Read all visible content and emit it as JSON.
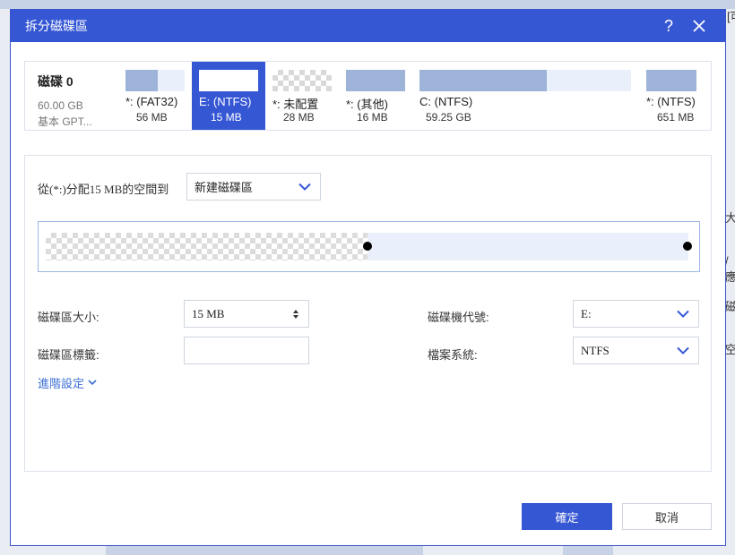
{
  "dialog": {
    "title": "拆分磁碟區",
    "help_icon": "?",
    "close_icon": "close-icon"
  },
  "disk": {
    "name": "磁碟 0",
    "size": "60.00 GB",
    "type": "基本 GPT..."
  },
  "partitions": [
    {
      "name": "*: (FAT32)",
      "size": "56 MB",
      "used_fraction": 0.55,
      "unallocated": false,
      "selected": false
    },
    {
      "name": "E: (NTFS)",
      "size": "15 MB",
      "used_fraction": 0.0,
      "unallocated": false,
      "selected": true
    },
    {
      "name": "*: 未配置",
      "size": "28 MB",
      "used_fraction": 0.0,
      "unallocated": true,
      "selected": false
    },
    {
      "name": "*: (其他)",
      "size": "16 MB",
      "used_fraction": 1.0,
      "unallocated": false,
      "selected": false
    },
    {
      "name": "C: (NTFS)",
      "size": "59.25 GB",
      "used_fraction": 0.6,
      "unallocated": false,
      "selected": false
    },
    {
      "name": "*: (NTFS)",
      "size": "651 MB",
      "used_fraction": 1.0,
      "unallocated": false,
      "selected": false
    }
  ],
  "allocate": {
    "label": "從(*:)分配15 MB的空間到",
    "target": "新建磁碟區"
  },
  "slider": {
    "unallocated_fraction": 0.5
  },
  "form": {
    "size_label": "磁碟區大小:",
    "size_value": "15 MB",
    "label_label": "磁碟區標籤:",
    "label_value": "",
    "drive_letter_label": "磁碟機代號:",
    "drive_letter_value": "E:",
    "filesystem_label": "檔案系統:",
    "filesystem_value": "NTFS"
  },
  "advanced": "進階設定",
  "buttons": {
    "ok": "確定",
    "cancel": "取消"
  },
  "background": {
    "side_text": [
      "大",
      "/應",
      "磁",
      "空"
    ],
    "top_text": "[可"
  },
  "colors": {
    "accent": "#3657d4",
    "used_bar": "#9db3d8",
    "link": "#3b6fd4"
  }
}
